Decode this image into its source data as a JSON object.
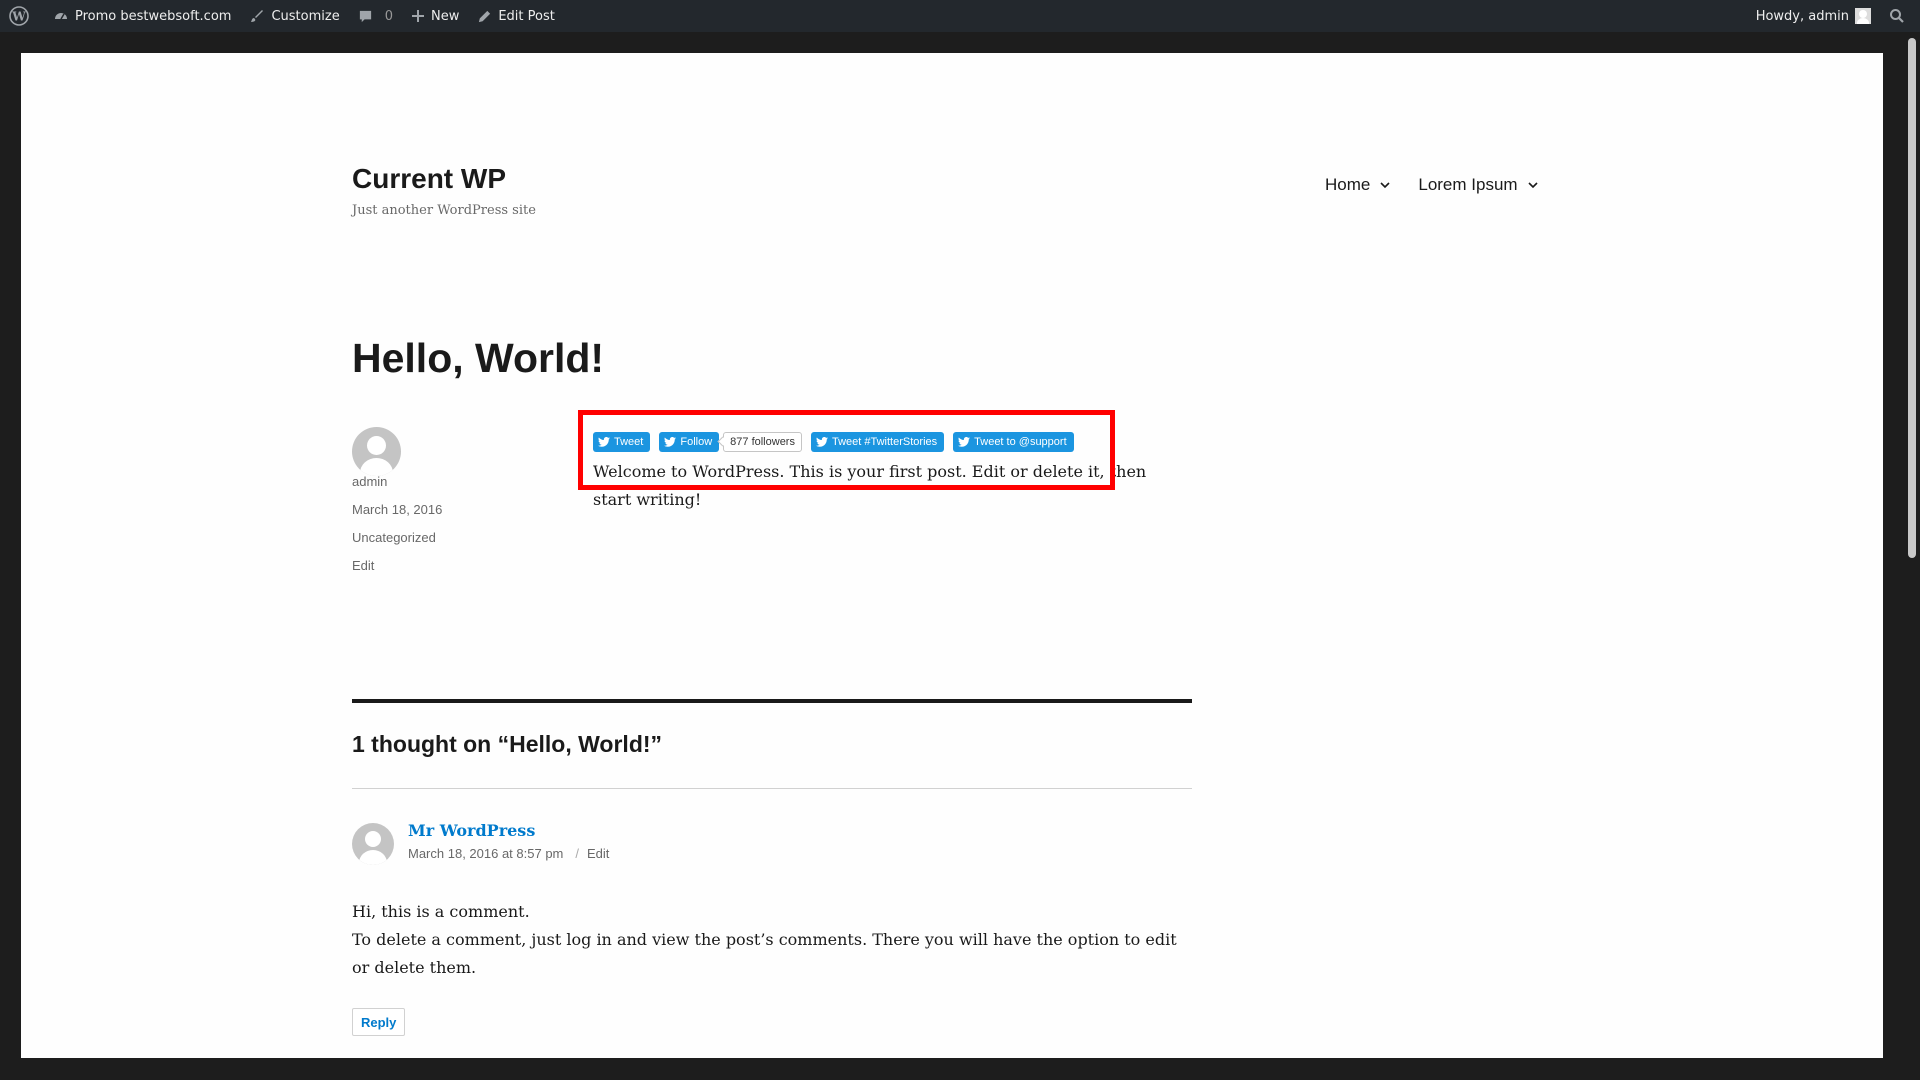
{
  "adminbar": {
    "site_name": "Promo bestwebsoft.com",
    "customize": "Customize",
    "comments_count": "0",
    "new": "New",
    "edit_post": "Edit Post",
    "howdy": "Howdy, admin"
  },
  "site": {
    "title": "Current WP",
    "description": "Just another WordPress site",
    "nav": [
      {
        "label": "Home"
      },
      {
        "label": "Lorem Ipsum"
      }
    ]
  },
  "post": {
    "title": "Hello, World!",
    "author": "admin",
    "date": "March 18, 2016",
    "category": "Uncategorized",
    "edit": "Edit",
    "content": "Welcome to WordPress. This is your first post. Edit or delete it, then start writing!"
  },
  "share": {
    "tweet": "Tweet",
    "follow": "Follow",
    "followers": "877 followers",
    "tweet_hashtag": "Tweet #TwitterStories",
    "tweet_mention": "Tweet to @support"
  },
  "comments": {
    "title": "1 thought on “Hello, World!”",
    "items": [
      {
        "author": "Mr WordPress",
        "date": "March 18, 2016 at 8:57 pm",
        "edit": "Edit",
        "line1": "Hi, this is a comment.",
        "line2": "To delete a comment, just log in and view the post’s comments. There you will have the option to edit or delete them.",
        "reply": "Reply"
      }
    ]
  },
  "colors": {
    "adminbar_bg": "#23282d",
    "link": "#007acc",
    "twitter_blue": "#1b95e0",
    "highlight": "#ff0000"
  },
  "icons": [
    "wordpress-icon",
    "dashboard-icon",
    "brush-icon",
    "comment-icon",
    "plus-icon",
    "pencil-icon",
    "search-icon",
    "twitter-bird-icon",
    "chevron-down-icon"
  ]
}
